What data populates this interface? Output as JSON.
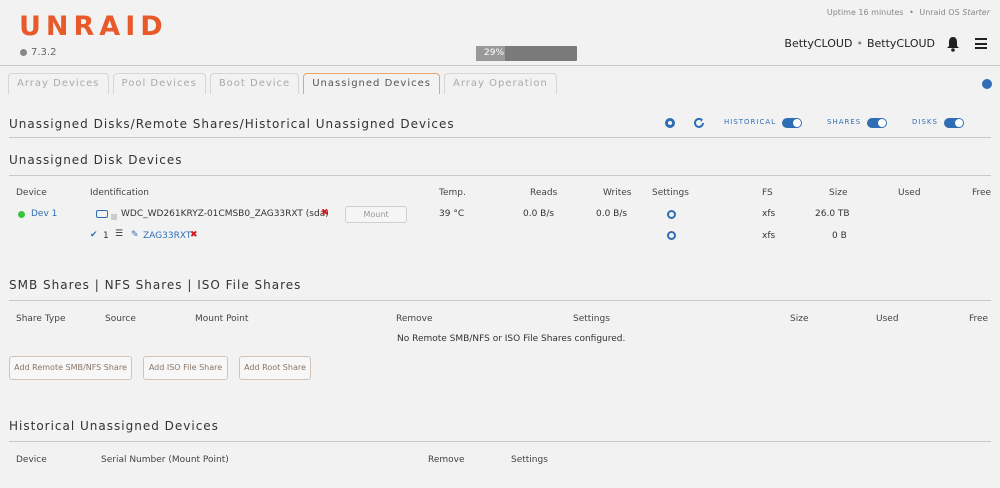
{
  "header": {
    "logo": "UNRAID",
    "version": "7.3.2",
    "uptime_prefix": "Uptime 16 minutes",
    "uptime_sep": "•",
    "os_prefix": "Unraid OS",
    "os_edition": "Starter",
    "progress_label": "29%",
    "progress_value": 0.29,
    "server_name": "BettyCLOUD",
    "server_sep": "•",
    "server_desc": "BettyCLOUD"
  },
  "tabs": [
    {
      "label": "Array Devices"
    },
    {
      "label": "Pool Devices"
    },
    {
      "label": "Boot Device"
    },
    {
      "label": "Unassigned Devices"
    },
    {
      "label": "Array Operation"
    }
  ],
  "main_title": "Unassigned Disks/Remote Shares/Historical Unassigned Devices",
  "toggles": {
    "historical": "HISTORICAL",
    "shares": "SHARES",
    "disks": "DISKS"
  },
  "disk_section": {
    "title": "Unassigned Disk Devices",
    "headers": [
      "Device",
      "Identification",
      "Temp.",
      "Reads",
      "Writes",
      "Settings",
      "FS",
      "Size",
      "Used",
      "Free"
    ],
    "device": "Dev 1",
    "identification": "WDC_WD261KRYZ-01CMSB0_ZAG33RXT (sda)",
    "mount_label": "Mount",
    "temp": "39 °C",
    "reads": "0.0 B/s",
    "writes": "0.0 B/s",
    "fs": "xfs",
    "size": "26.0 TB",
    "part_num": "1",
    "part_name": "ZAG33RXT",
    "part_fs": "xfs",
    "part_size": "0 B"
  },
  "shares_section": {
    "title": "SMB Shares | NFS Shares | ISO File Shares",
    "headers": [
      "Share Type",
      "Source",
      "Mount Point",
      "Remove",
      "Settings",
      "Size",
      "Used",
      "Free"
    ],
    "empty_msg": "No Remote SMB/NFS or ISO File Shares configured.",
    "buttons": [
      "Add Remote SMB/NFS Share",
      "Add ISO File Share",
      "Add Root Share"
    ]
  },
  "historical_section": {
    "title": "Historical Unassigned Devices",
    "headers": [
      "Device",
      "Serial Number (Mount Point)",
      "Remove",
      "Settings"
    ]
  }
}
